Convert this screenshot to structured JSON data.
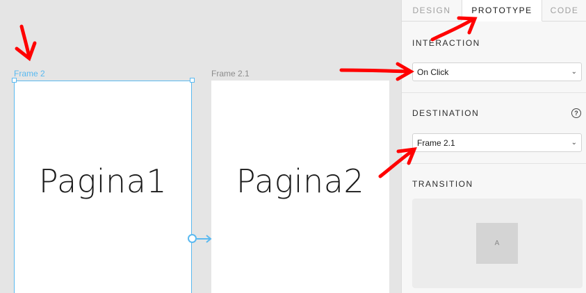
{
  "canvas": {
    "frames": [
      {
        "label": "Frame 2",
        "text": "Pagina1",
        "selected": true
      },
      {
        "label": "Frame 2.1",
        "text": "Pagina2",
        "selected": false
      }
    ]
  },
  "panel": {
    "tabs": [
      "DESIGN",
      "PROTOTYPE",
      "CODE"
    ],
    "active_tab": "PROTOTYPE",
    "interaction": {
      "title": "INTERACTION",
      "value": "On Click"
    },
    "destination": {
      "title": "DESTINATION",
      "value": "Frame 2.1",
      "help": "?"
    },
    "transition": {
      "title": "TRANSITION",
      "preview_label": "A"
    }
  },
  "colors": {
    "accent": "#5ab9f0",
    "annotation": "#ff0000"
  }
}
